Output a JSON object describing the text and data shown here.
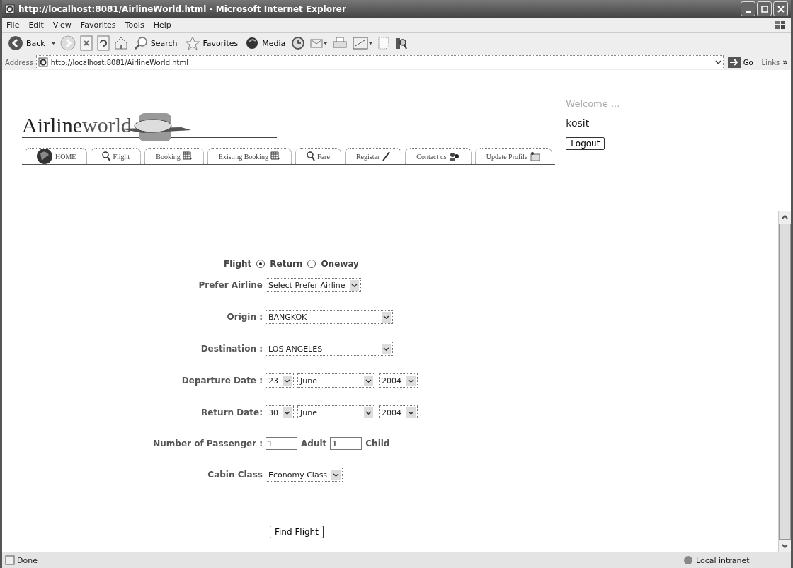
{
  "window": {
    "title": "http://localhost:8081/AirlineWorld.html - Microsoft Internet Explorer"
  },
  "menu": [
    "File",
    "Edit",
    "View",
    "Favorites",
    "Tools",
    "Help"
  ],
  "toolbar": {
    "back": "Back",
    "search": "Search",
    "favorites": "Favorites",
    "media": "Media"
  },
  "address": {
    "label": "Address",
    "value": "http://localhost:8081/AirlineWorld.html",
    "go": "Go",
    "links": "Links",
    "more": "»"
  },
  "site": {
    "logo_main": "Airline",
    "logo_rest": "world",
    "tabs": [
      {
        "label": "HOME"
      },
      {
        "label": "Flight"
      },
      {
        "label": "Booking"
      },
      {
        "label": "Existing Booking"
      },
      {
        "label": "Fare"
      },
      {
        "label": "Register"
      },
      {
        "label": "Contact us"
      },
      {
        "label": "Update Profile"
      }
    ],
    "welcome": "Welcome ...",
    "user": "kosit",
    "logout": "Logout"
  },
  "form": {
    "flight_label": "Flight",
    "trip_types": [
      {
        "label": "Return",
        "selected": true
      },
      {
        "label": "Oneway",
        "selected": false
      }
    ],
    "fields": [
      {
        "label": "Prefer Airline",
        "kind": "selects",
        "values": [
          "Select Prefer Airline"
        ]
      },
      {
        "label": "Origin :",
        "kind": "selects",
        "values": [
          "BANGKOK"
        ]
      },
      {
        "label": "Destination :",
        "kind": "selects",
        "values": [
          "LOS ANGELES"
        ]
      },
      {
        "label": "Departure Date :",
        "kind": "selects",
        "values": [
          "23",
          "June",
          "2004"
        ]
      },
      {
        "label": "Return Date:",
        "kind": "selects",
        "values": [
          "30",
          "June",
          "2004"
        ]
      },
      {
        "label": "Number of Passenger :",
        "kind": "passengers",
        "inputs": [
          {
            "value": "1",
            "suffix": "Adult"
          },
          {
            "value": "1",
            "suffix": "Child"
          }
        ]
      },
      {
        "label": "Cabin Class",
        "kind": "selects",
        "values": [
          "Economy Class"
        ]
      }
    ],
    "submit": "Find Flight"
  },
  "status_bar": {
    "text": "Done",
    "zone": "Local intranet"
  }
}
